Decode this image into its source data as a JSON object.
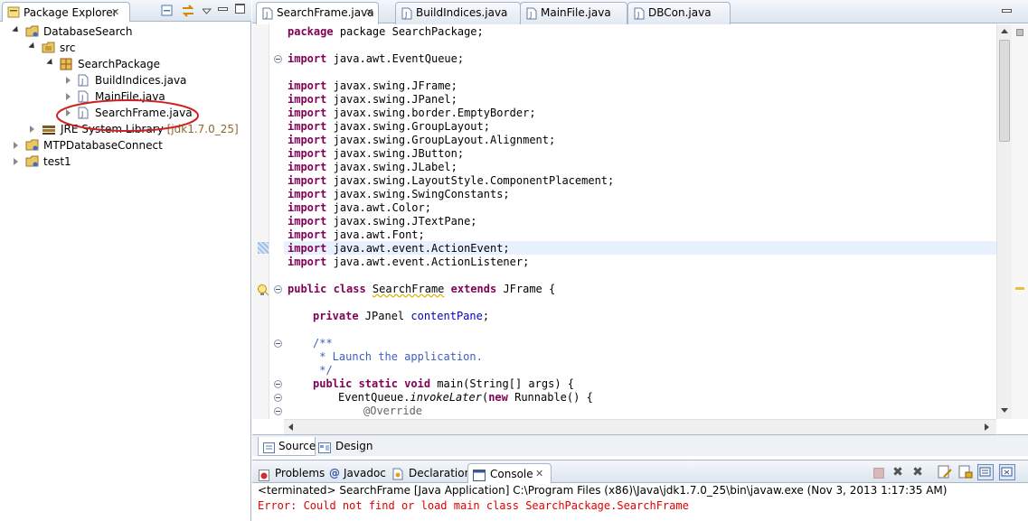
{
  "package_explorer": {
    "title": "Package Explorer",
    "tree": [
      {
        "label": "DatabaseSearch",
        "icon": "project-icon"
      },
      {
        "label": "src",
        "icon": "source-folder-icon"
      },
      {
        "label": "SearchPackage",
        "icon": "package-icon"
      },
      {
        "label": "BuildIndices.java",
        "icon": "java-file-icon"
      },
      {
        "label": "MainFile.java",
        "icon": "java-file-icon"
      },
      {
        "label": "SearchFrame.java",
        "icon": "java-file-icon"
      },
      {
        "label": "JRE System Library",
        "suffix": " [jdk1.7.0_25]",
        "icon": "library-icon"
      },
      {
        "label": "MTPDatabaseConnect",
        "icon": "project-icon"
      },
      {
        "label": "test1",
        "icon": "project-icon"
      }
    ],
    "highlight_color": "#cc2222"
  },
  "editor": {
    "tabs": [
      "SearchFrame.java",
      "BuildIndices.java",
      "MainFile.java",
      "DBCon.java"
    ],
    "active_tab": "SearchFrame.java",
    "bottom_tabs": [
      "Source",
      "Design"
    ]
  },
  "code": {
    "l1": "package SearchPackage;",
    "l3": "import java.awt.EventQueue;",
    "imports": [
      "javax.swing.JFrame;",
      "javax.swing.JPanel;",
      "javax.swing.border.EmptyBorder;",
      "javax.swing.GroupLayout;",
      "javax.swing.GroupLayout.Alignment;",
      "javax.swing.JButton;",
      "javax.swing.JLabel;",
      "javax.swing.LayoutStyle.ComponentPlacement;",
      "javax.swing.SwingConstants;",
      "java.awt.Color;",
      "javax.swing.JTextPane;",
      "java.awt.Font;",
      "java.awt.event.ActionEvent;",
      "java.awt.event.ActionListener;"
    ],
    "class_decl": {
      "kw1": "public class ",
      "name": "SearchFrame",
      "kw2": " extends ",
      "rest": "JFrame {"
    },
    "field": {
      "kw": "private ",
      "type": "JPanel ",
      "name": "contentPane",
      "end": ";"
    },
    "comment": [
      "/**",
      " * Launch the application.",
      " */"
    ],
    "main_decl": {
      "kw": "public static void ",
      "rest": "main(String[] args) {"
    },
    "invoke": {
      "pre": "EventQueue.",
      "method": "invokeLater",
      "open": "(",
      "kw": "new ",
      "rest": "Runnable() {"
    },
    "override": "@Override",
    "keyword_import": "import"
  },
  "console": {
    "tabs": [
      "Problems",
      "Javadoc",
      "Declaration",
      "Console"
    ],
    "active_tab": "Console",
    "status": "<terminated> SearchFrame [Java Application] C:\\Program Files (x86)\\Java\\jdk1.7.0_25\\bin\\javaw.exe (Nov 3, 2013 1:17:35 AM)",
    "error": "Error: Could not find or load main class SearchPackage.SearchFrame",
    "error_color": "#e00000"
  }
}
